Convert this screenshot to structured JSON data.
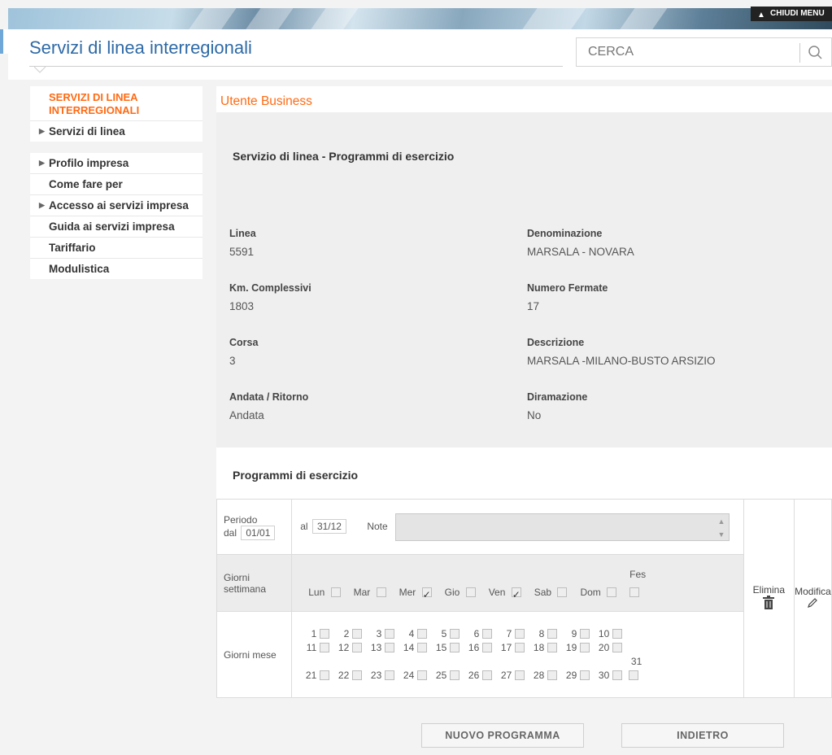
{
  "header": {
    "close_menu_label": "CHIUDI MENU",
    "site_title": "Servizi di linea interregionali",
    "search_placeholder": "CERCA"
  },
  "sidebar": {
    "section_heading": "SERVIZI DI LINEA INTERREGIONALI",
    "group1": [
      {
        "label": "Servizi di linea",
        "arrow": true
      }
    ],
    "group2": [
      {
        "label": "Profilo impresa",
        "arrow": true
      },
      {
        "label": "Come fare per",
        "arrow": false
      },
      {
        "label": "Accesso ai servizi impresa",
        "arrow": true
      },
      {
        "label": "Guida ai servizi impresa",
        "arrow": false
      },
      {
        "label": "Tariffario",
        "arrow": false
      },
      {
        "label": "Modulistica",
        "arrow": false
      }
    ]
  },
  "main": {
    "user_heading": "Utente Business",
    "section_title": "Servizio di linea - Programmi di esercizio",
    "fields": {
      "linea_label": "Linea",
      "linea_value": "5591",
      "denominazione_label": "Denominazione",
      "denominazione_value": "MARSALA - NOVARA",
      "km_label": "Km. Complessivi",
      "km_value": "1803",
      "fermate_label": "Numero Fermate",
      "fermate_value": "17",
      "corsa_label": "Corsa",
      "corsa_value": "3",
      "descrizione_label": "Descrizione",
      "descrizione_value": "MARSALA -MILANO-BUSTO ARSIZIO",
      "andata_label": "Andata / Ritorno",
      "andata_value": "Andata",
      "diramazione_label": "Diramazione",
      "diramazione_value": "No"
    },
    "programmi_title": "Programmi di esercizio",
    "program": {
      "periodo_label": "Periodo",
      "dal_label": "dal",
      "dal_value": "01/01",
      "al_label": "al",
      "al_value": "31/12",
      "note_label": "Note",
      "giorni_settimana_label": "Giorni settimana",
      "weekdays": [
        {
          "label": "Lun",
          "checked": false
        },
        {
          "label": "Mar",
          "checked": false
        },
        {
          "label": "Mer",
          "checked": true
        },
        {
          "label": "Gio",
          "checked": false
        },
        {
          "label": "Ven",
          "checked": true
        },
        {
          "label": "Sab",
          "checked": false
        },
        {
          "label": "Dom",
          "checked": false
        },
        {
          "label": "Fes",
          "checked": false
        }
      ],
      "giorni_mese_label": "Giorni mese",
      "month_days": [
        "1",
        "2",
        "3",
        "4",
        "5",
        "6",
        "7",
        "8",
        "9",
        "10",
        "11",
        "12",
        "13",
        "14",
        "15",
        "16",
        "17",
        "18",
        "19",
        "20",
        "21",
        "22",
        "23",
        "24",
        "25",
        "26",
        "27",
        "28",
        "29",
        "30",
        "31"
      ],
      "elimina_label": "Elimina",
      "modifica_label": "Modifica"
    },
    "buttons": {
      "nuovo_programma": "NUOVO PROGRAMMA",
      "indietro": "INDIETRO"
    }
  }
}
